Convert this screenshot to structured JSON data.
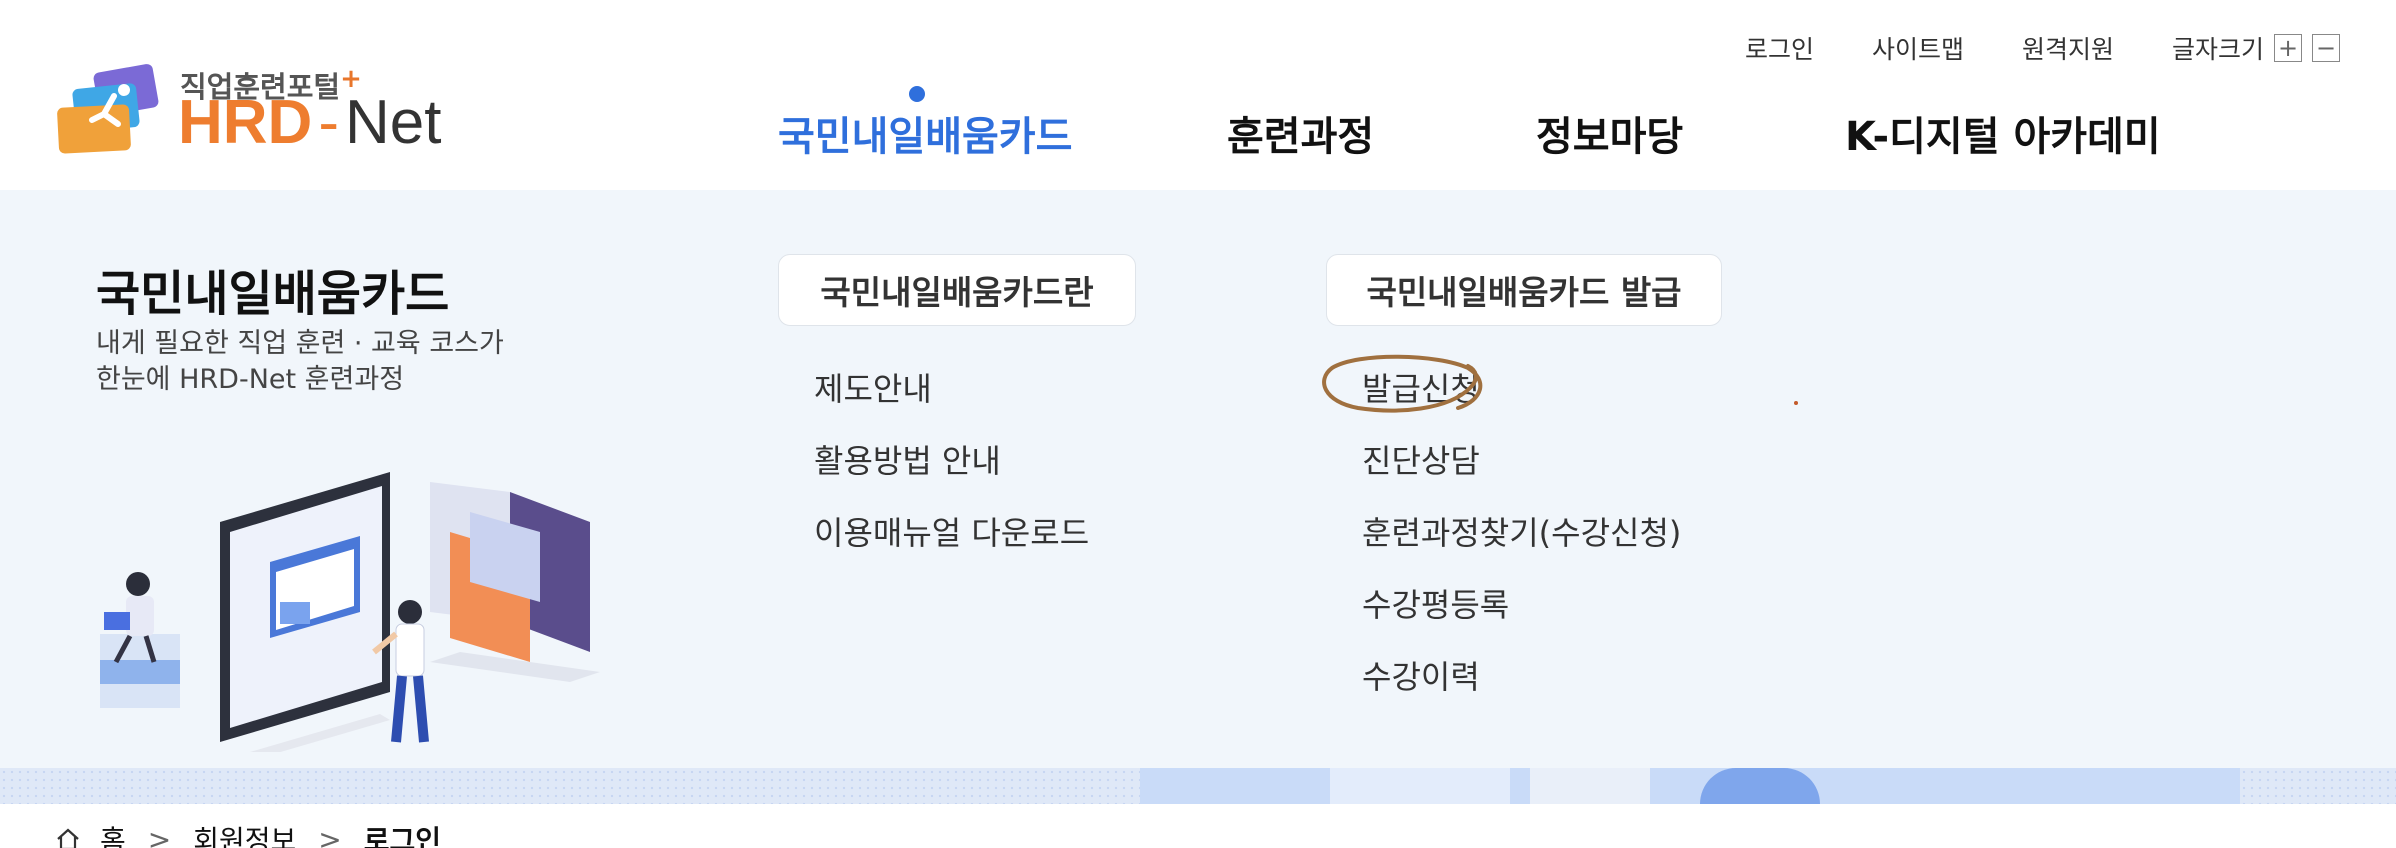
{
  "logo": {
    "tagline": "직업훈련포털",
    "tagline_plus": "+",
    "brand_hrd": "HRD",
    "brand_dash": "-",
    "brand_net": "Net",
    "icon": "hrd-net-logo-mark"
  },
  "utility": {
    "login": "로그인",
    "sitemap": "사이트맵",
    "remote_support": "원격지원",
    "font_size_label": "글자크기",
    "font_plus": "+",
    "font_minus": "−"
  },
  "gnb": {
    "items": [
      {
        "label": "국민내일배움카드",
        "active": true
      },
      {
        "label": "훈련과정",
        "active": false
      },
      {
        "label": "정보마당",
        "active": false
      },
      {
        "label": "K-디지털 아카데미",
        "active": false
      }
    ]
  },
  "panel": {
    "title": "국민내일배움카드",
    "desc_line1": "내게 필요한 직업 훈련 · 교육 코스가",
    "desc_line2": "한눈에 HRD-Net 훈련과정",
    "illustration": "online-training-illustration",
    "groups": [
      {
        "heading": "국민내일배움카드란",
        "links": [
          "제도안내",
          "활용방법 안내",
          "이용매뉴얼 다운로드"
        ]
      },
      {
        "heading": "국민내일배움카드 발급",
        "links": [
          "발급신청",
          "진단상담",
          "훈련과정찾기(수강신청)",
          "수강평등록",
          "수강이력"
        ]
      }
    ]
  },
  "breadcrumb": {
    "home": "홈",
    "level1": "회원정보",
    "current": "로그인",
    "separator": ">"
  },
  "colors": {
    "accent": "#2f6fdc",
    "brand_orange": "#ee7d2f",
    "panel_bg": "#f1f6fb",
    "annotation": "#a0703f"
  }
}
